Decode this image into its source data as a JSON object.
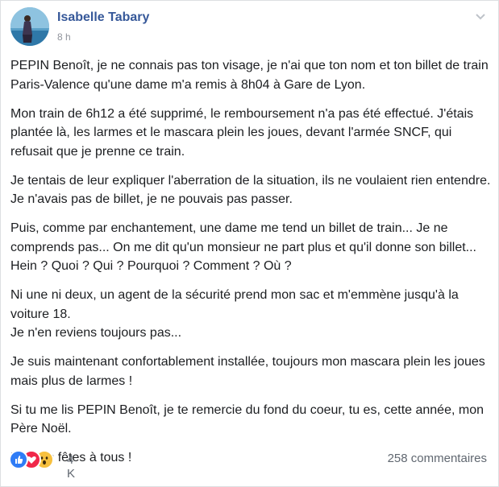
{
  "author": {
    "name": "Isabelle Tabary",
    "time": "8 h"
  },
  "post": {
    "paragraphs": [
      "PEPIN Benoît, je ne connais pas ton visage, je n'ai que ton nom et ton billet de train Paris-Valence qu'une dame m'a remis à 8h04 à Gare de Lyon.",
      "Mon train de 6h12 a été supprimé, le remboursement n'a pas été effectué. J'étais plantée là, les larmes et le mascara plein les joues, devant l'armée SNCF, qui refusait que je prenne ce train.",
      "Je tentais de leur expliquer l'aberration de la situation, ils ne voulaient rien entendre. Je n'avais pas de billet, je ne pouvais pas passer.",
      "Puis, comme par enchantement, une dame me tend un billet de train... Je ne comprends pas... On me dit qu'un monsieur ne part plus et qu'il donne son billet... Hein ? Quoi ? Qui ? Pourquoi ? Comment ? Où ?",
      "Ni une ni deux, un agent de la sécurité prend mon sac et m'emmène jusqu'à la voiture 18.\nJe n'en reviens toujours pas...",
      "Je suis maintenant confortablement installée, toujours mon mascara plein les joues mais plus de larmes !",
      "Si tu me lis PEPIN Benoît, je te remercie du fond du coeur, tu es, cette année, mon Père Noël.",
      "Bonnes fêtes à tous !"
    ]
  },
  "reactions": {
    "icons": [
      "like-icon",
      "love-icon",
      "wow-icon"
    ],
    "colors": {
      "like": "#2f7cf6",
      "love": "#f0284a",
      "wow": "#f7c03e"
    },
    "count": "4 K"
  },
  "comments": {
    "label": "258 commentaires"
  }
}
